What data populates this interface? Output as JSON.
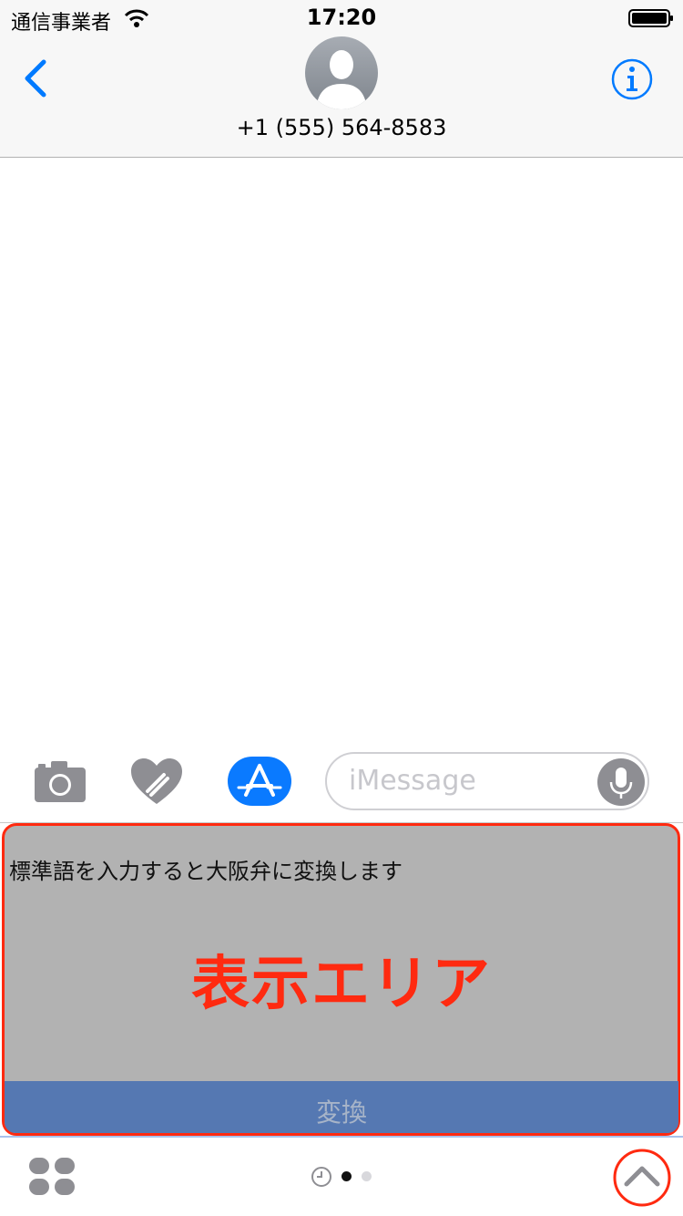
{
  "status_bar": {
    "carrier": "通信事業者",
    "time": "17:20"
  },
  "header": {
    "contact": "+1 (555) 564-8583"
  },
  "compose": {
    "placeholder": "iMessage",
    "icons": [
      "camera-icon",
      "digital-touch-heart-icon",
      "app-store-icon",
      "microphone-icon"
    ]
  },
  "extension": {
    "description": "標準語を入力すると大阪弁に変換します",
    "display_label": "表示エリア",
    "convert_button": "変換"
  },
  "bottom_bar": {
    "page_dots": 2,
    "active_dot": 1
  },
  "colors": {
    "accent": "#007aff",
    "annotation_red": "#ff2a10",
    "extension_bg": "#b2b2b2",
    "convert_bar": "#5578b2"
  }
}
